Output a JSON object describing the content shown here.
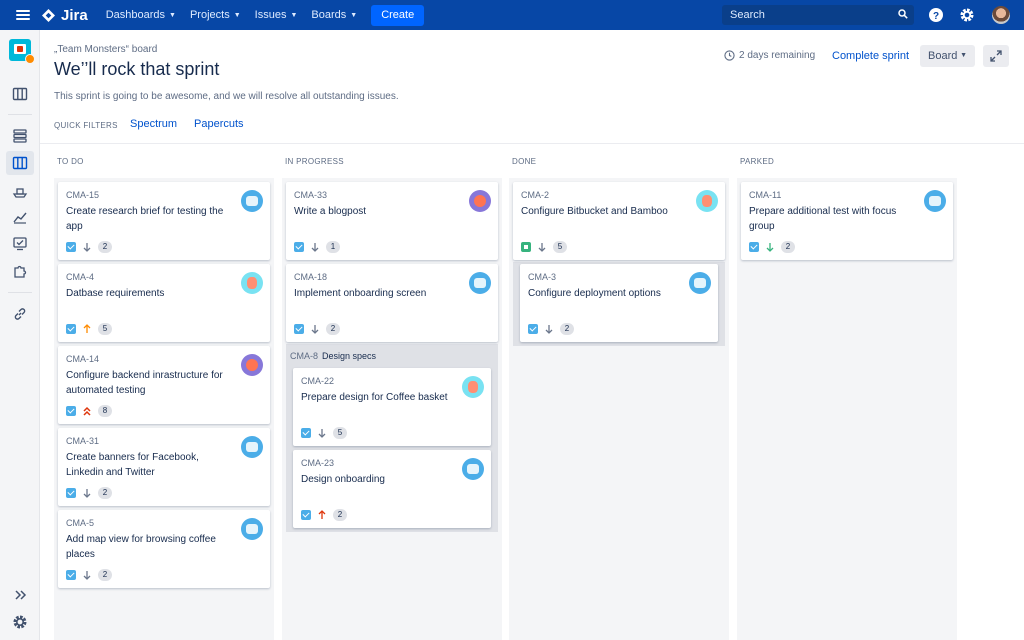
{
  "topnav": {
    "brand": "Jira",
    "menu": [
      {
        "label": "Dashboards"
      },
      {
        "label": "Projects"
      },
      {
        "label": "Issues"
      },
      {
        "label": "Boards"
      }
    ],
    "create_label": "Create",
    "search_placeholder": "Search"
  },
  "header": {
    "board_name": "„Team Monsters“ board",
    "title": "We’’ll rock that sprint",
    "description": "This sprint is going to be awesome, and we will resolve all outstanding issues.",
    "quick_filters_label": "QUICK FILTERS",
    "quick_filters": [
      "Spectrum",
      "Papercuts"
    ],
    "remaining": "2 days remaining",
    "complete_sprint": "Complete sprint",
    "board_button": "Board"
  },
  "columns": [
    {
      "title": "TO DO",
      "cards": [
        {
          "key": "CMA-15",
          "summary": "Create research brief for testing the app",
          "type": "task",
          "priority": "low",
          "points": "2",
          "avatar": "blue"
        },
        {
          "key": "CMA-4",
          "summary": "Datbase requirements",
          "type": "task",
          "priority": "medium",
          "points": "5",
          "avatar": "teal"
        },
        {
          "key": "CMA-14",
          "summary": "Configure backend inrastructure for automated testing",
          "type": "task",
          "priority": "highest",
          "points": "8",
          "avatar": "purple"
        },
        {
          "key": "CMA-31",
          "summary": "Create banners for Facebook, Linkedin and Twitter",
          "type": "task",
          "priority": "low",
          "points": "2",
          "avatar": "blue"
        },
        {
          "key": "CMA-5",
          "summary": "Add map view for browsing coffee places",
          "type": "task",
          "priority": "low",
          "points": "2",
          "avatar": "blue"
        }
      ]
    },
    {
      "title": "IN PROGRESS",
      "cards": [
        {
          "key": "CMA-33",
          "summary": "Write a blogpost",
          "type": "task",
          "priority": "low",
          "points": "1",
          "avatar": "purple"
        },
        {
          "key": "CMA-18",
          "summary": "Implement onboarding screen",
          "type": "task",
          "priority": "low",
          "points": "2",
          "avatar": "blue"
        }
      ],
      "group": {
        "key": "CMA-8",
        "name": "Design specs",
        "cards": [
          {
            "key": "CMA-22",
            "summary": "Prepare design for Coffee basket",
            "type": "task",
            "priority": "low",
            "points": "5",
            "avatar": "teal"
          },
          {
            "key": "CMA-23",
            "summary": "Design onboarding",
            "type": "task",
            "priority": "high",
            "points": "2",
            "avatar": "blue"
          }
        ]
      }
    },
    {
      "title": "DONE",
      "cards": [
        {
          "key": "CMA-2",
          "summary": "Configure Bitbucket and Bamboo",
          "type": "story",
          "priority": "low",
          "points": "5",
          "avatar": "teal"
        }
      ],
      "subcards": [
        {
          "key": "CMA-3",
          "summary": "Configure deployment options",
          "type": "task",
          "priority": "low",
          "points": "2",
          "avatar": "blue"
        }
      ]
    },
    {
      "title": "PARKED",
      "cards": [
        {
          "key": "CMA-11",
          "summary": "Prepare additional test with focus group",
          "type": "task",
          "priority": "lowest",
          "points": "2",
          "avatar": "blue"
        }
      ]
    }
  ],
  "colors": {
    "nav_bg": "#0747a6",
    "link": "#0052cc",
    "priority_medium": "#ff8b00",
    "priority_high": "#de350b",
    "priority_lowest": "#36b37e"
  }
}
